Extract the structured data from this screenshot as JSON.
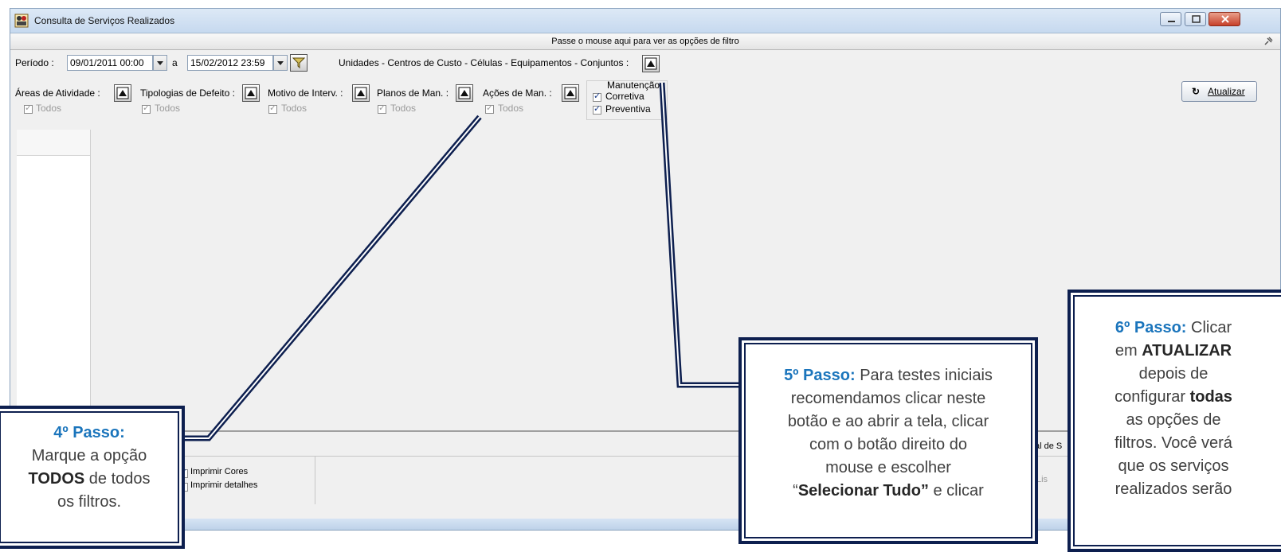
{
  "window": {
    "title": "Consulta de Serviços Realizados",
    "filter_hint": "Passe o mouse aqui para ver as opções de filtro"
  },
  "period": {
    "label": "Período :",
    "from": "09/01/2011 00:00",
    "to_label": "a",
    "to": "15/02/2012 23:59"
  },
  "units_label": "Unidades - Centros de Custo - Células - Equipamentos - Conjuntos :",
  "filters": [
    {
      "label": "Áreas de Atividade :",
      "todos": "Todos"
    },
    {
      "label": "Tipologias de Defeito :",
      "todos": "Todos"
    },
    {
      "label": "Motivo de Interv. :",
      "todos": "Todos"
    },
    {
      "label": "Planos de Man. :",
      "todos": "Todos"
    },
    {
      "label": "Ações de Man. :",
      "todos": "Todos"
    }
  ],
  "manutencao": {
    "label": "Manutenção",
    "corretiva": "Corretiva",
    "preventiva": "Preventiva"
  },
  "update_button": "Atualizar",
  "print": {
    "cores": "Imprimir Cores",
    "detalhes": "Imprimir detalhes"
  },
  "total_partial": "al de S",
  "list_partial": "Lis",
  "callouts": {
    "step4": {
      "title": "4º Passo:",
      "line1": "Marque  a opção",
      "bold": "TODOS",
      "line2": " de todos",
      "line3": "os filtros."
    },
    "step5": {
      "title": "5º Passo:",
      "t1": " Para testes iniciais",
      "t2": "recomendamos clicar neste",
      "t3": "botão e ao abrir a tela, clicar",
      "t4": "com o botão direito do",
      "t5": "mouse e escolher",
      "t6_pre": "“",
      "t6_bold": "Selecionar Tudo”",
      "t6_post": " e clicar"
    },
    "step6": {
      "title": "6º Passo:",
      "t1": " Clicar",
      "t2_pre": "em ",
      "t2_bold": "ATUALIZAR",
      "t3": "depois de",
      "t4_pre": "configurar ",
      "t4_bold": "todas",
      "t5": "as opções de",
      "t6": "filtros. Você verá",
      "t7": "que os serviços",
      "t8": "realizados serão"
    }
  }
}
